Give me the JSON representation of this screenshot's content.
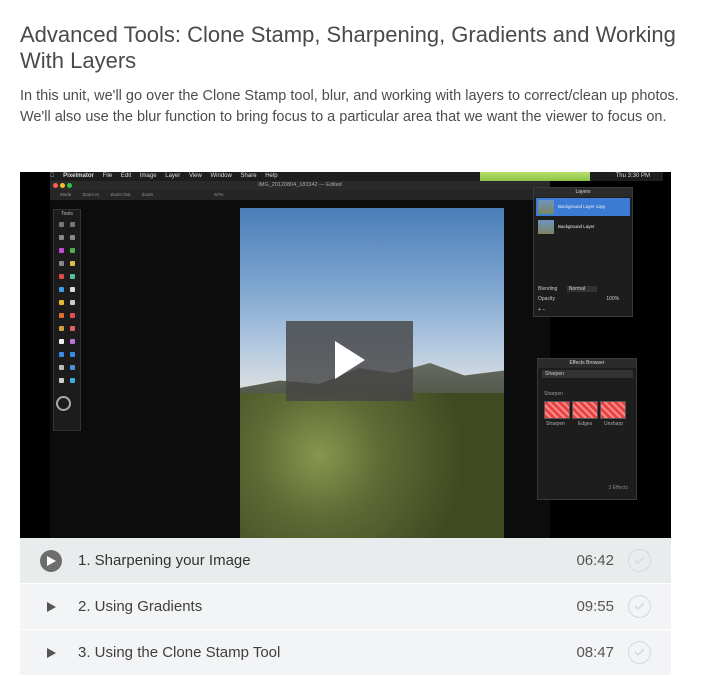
{
  "unit": {
    "title": "Advanced Tools: Clone Stamp, Sharpening, Gradients and Working With Layers",
    "description": "In this unit, we'll go over the Clone Stamp tool, blur, and working with layers to correct/clean up photos. We'll also use the blur function to bring focus to a particular area that we want the viewer to focus on."
  },
  "video": {
    "menubar": [
      "Pixelmator",
      "File",
      "Edit",
      "Image",
      "Layer",
      "View",
      "Window",
      "Share",
      "Help"
    ],
    "clock": "Thu 3:30 PM",
    "window_title": "IMG_20120804_183342 — Edited",
    "options": [
      "Mode",
      "Zoom In",
      "Zoom Out",
      "Zoom",
      "67%"
    ],
    "tools_label": "Tools",
    "layers_panel": {
      "title": "Layers",
      "items": [
        "Background Layer copy",
        "Background Layer"
      ],
      "blending_label": "Blending",
      "blending_value": "Normal",
      "opacity_label": "Opacity",
      "opacity_value": "100%"
    },
    "effects_panel": {
      "title": "Effects Browser",
      "category": "Sharpen",
      "group": "Sharpen",
      "effects": [
        "Sharpen",
        "Edges",
        "Unsharp"
      ],
      "count": "3 Effects"
    },
    "play_icon": "play-icon"
  },
  "lessons": [
    {
      "label": "1. Sharpening your Image",
      "duration": "06:42",
      "active": true
    },
    {
      "label": "2. Using Gradients",
      "duration": "09:55",
      "active": false
    },
    {
      "label": "3. Using the Clone Stamp Tool",
      "duration": "08:47",
      "active": false
    }
  ],
  "colors": {
    "text": "#4a4a4a",
    "row_bg": "#f2f4f5",
    "active_row_bg": "#e9eced",
    "play_overlay": "#464646"
  }
}
